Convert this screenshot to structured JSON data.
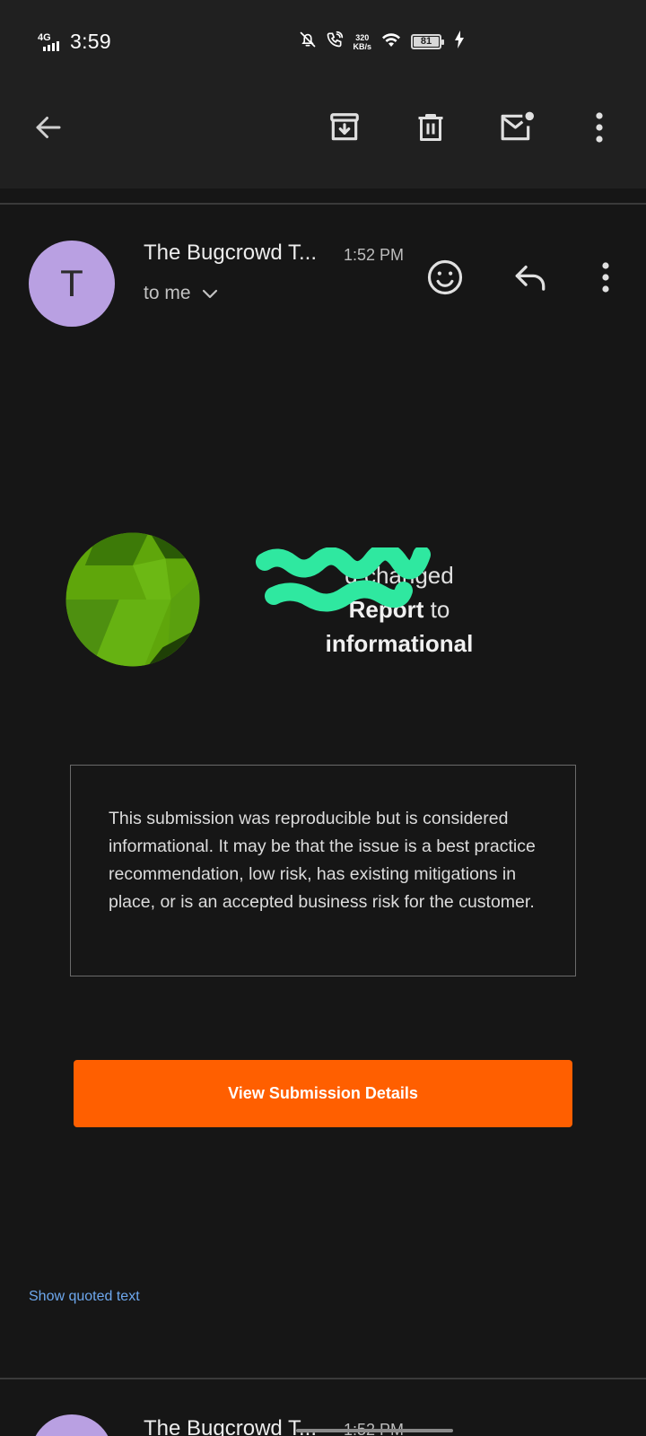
{
  "status_bar": {
    "network": "4G",
    "time": "3:59",
    "speed_value": "320",
    "speed_unit": "KB/s",
    "battery": "81",
    "icons": [
      "mute-notification-icon",
      "wifi-calling-icon",
      "wifi-icon",
      "battery-icon",
      "charging-icon"
    ]
  },
  "toolbar": {
    "icons": [
      "back-arrow-icon",
      "archive-icon",
      "delete-icon",
      "mark-unread-icon",
      "more-options-icon"
    ]
  },
  "message": {
    "sender_initial": "T",
    "sender_name": "The Bugcrowd T...",
    "time": "1:52 PM",
    "recipient": "to me",
    "actions": [
      "emoji-react-icon",
      "reply-icon",
      "more-options-icon"
    ]
  },
  "email_body": {
    "headline_prefix": "d changed",
    "headline_bold": "Report",
    "headline_mid": "to",
    "headline_status": "informational",
    "info_text": "This submission was reproducible but is considered informational. It may be that the issue is a best practice recommendation, low risk, has existing mitigations in place, or is an accepted business risk for the customer.",
    "cta_label": "View Submission Details",
    "show_quoted": "Show quoted text"
  },
  "next_message": {
    "sender_name": "The Bugcrowd T...",
    "time": "1:52 PM"
  },
  "colors": {
    "background": "#161616",
    "header": "#202020",
    "avatar": "#b9a0e2",
    "cta": "#ff5f00",
    "link": "#6ea8ee",
    "redaction": "#2fe8a0"
  }
}
